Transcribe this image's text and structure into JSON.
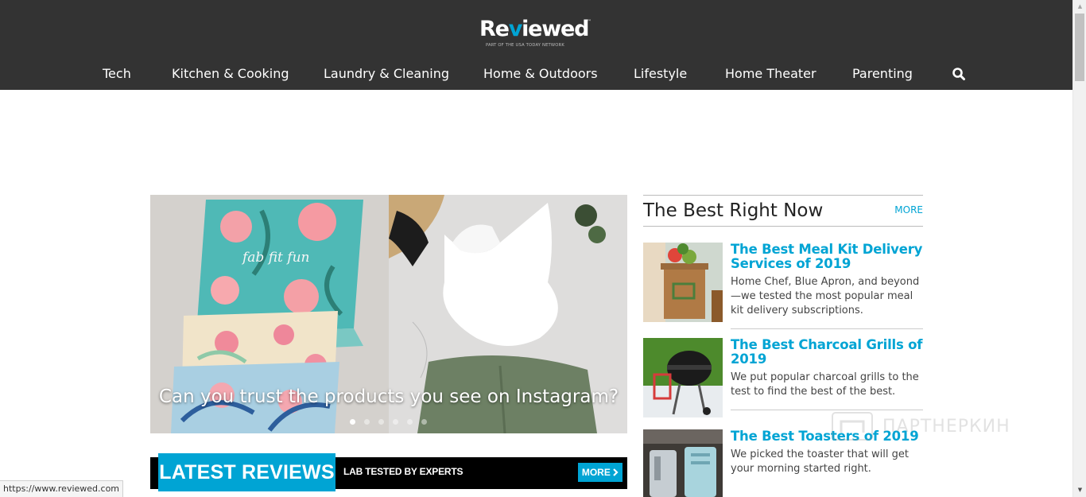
{
  "header": {
    "logo_text": "Reviewed",
    "logo_tagline": "PART OF THE USA TODAY NETWORK",
    "logo_trademark": "™",
    "nav": [
      {
        "label": "Tech"
      },
      {
        "label": "Kitchen & Cooking"
      },
      {
        "label": "Laundry & Cleaning"
      },
      {
        "label": "Home & Outdoors"
      },
      {
        "label": "Lifestyle"
      },
      {
        "label": "Home Theater"
      },
      {
        "label": "Parenting"
      }
    ],
    "search_icon": "search-icon"
  },
  "hero": {
    "caption": "Can you trust the products you see on Instagram?",
    "slide_count": 6,
    "active_slide": 1
  },
  "latest": {
    "title": "LATEST REVIEWS",
    "subtitle": "LAB TESTED BY EXPERTS",
    "more_label": "MORE",
    "more_icon": "chevron-right-icon"
  },
  "sidebar": {
    "title": "The Best Right Now",
    "more_label": "MORE",
    "cards": [
      {
        "title": "The Best Meal Kit Delivery Services of 2019",
        "desc": "Home Chef, Blue Apron, and beyond—we tested the most popular meal kit delivery subscriptions."
      },
      {
        "title": "The Best Charcoal Grills of 2019",
        "desc": "We put popular charcoal grills to the test to find the best of the best."
      },
      {
        "title": "The Best Toasters of 2019",
        "desc": "We picked the toaster that will get your morning started right."
      }
    ]
  },
  "watermark": {
    "text": "ПАРТНЕРКИН"
  },
  "status_bar": {
    "url": "https://www.reviewed.com"
  },
  "colors": {
    "header_bg": "#333333",
    "accent": "#00a4d4",
    "bar_bg": "#000000"
  }
}
